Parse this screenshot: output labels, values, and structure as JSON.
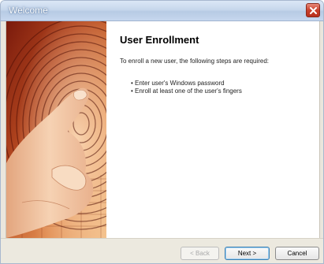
{
  "window": {
    "title": "Welcome"
  },
  "page": {
    "heading": "User Enrollment",
    "intro": "To enroll a new user, the following steps are required:",
    "steps": [
      "Enter user's Windows password",
      "Enroll at least one of the user's fingers"
    ],
    "bullet": "•"
  },
  "footer": {
    "back_label": "< Back",
    "next_label": "Next >",
    "cancel_label": "Cancel"
  },
  "colors": {
    "titlebar": "#c7d7ec",
    "close_button": "#c9402b",
    "art_primary": "#b3461f",
    "art_skin": "#f0c19c",
    "default_button_border": "#3c7fb1"
  },
  "icons": {
    "close": "close-icon",
    "art": "fingerprint-hand-illustration"
  }
}
